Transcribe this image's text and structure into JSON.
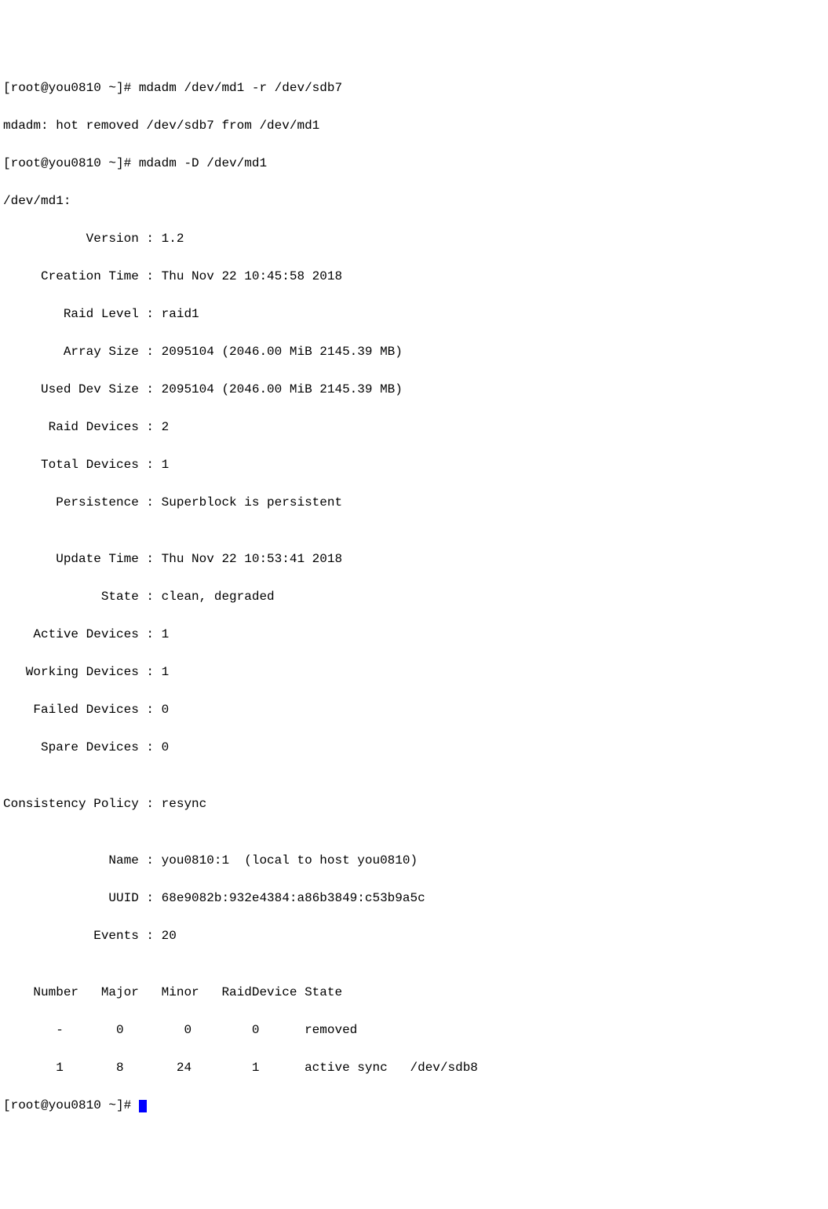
{
  "lines": {
    "l0": "[root@you0810 ~]# mdadm /dev/md1 -r /dev/sdb7",
    "l1": "mdadm: hot removed /dev/sdb7 from /dev/md1",
    "l2": "[root@you0810 ~]# mdadm -D /dev/md1",
    "l3": "/dev/md1:",
    "l4": "           Version : 1.2",
    "l5": "     Creation Time : Thu Nov 22 10:45:58 2018",
    "l6": "        Raid Level : raid1",
    "l7": "        Array Size : 2095104 (2046.00 MiB 2145.39 MB)",
    "l8": "     Used Dev Size : 2095104 (2046.00 MiB 2145.39 MB)",
    "l9": "      Raid Devices : 2",
    "l10": "     Total Devices : 1",
    "l11": "       Persistence : Superblock is persistent",
    "l12": "",
    "l13": "       Update Time : Thu Nov 22 10:53:41 2018",
    "l14": "             State : clean, degraded",
    "l15": "    Active Devices : 1",
    "l16": "   Working Devices : 1",
    "l17": "    Failed Devices : 0",
    "l18": "     Spare Devices : 0",
    "l19": "",
    "l20": "Consistency Policy : resync",
    "l21": "",
    "l22": "              Name : you0810:1  (local to host you0810)",
    "l23": "              UUID : 68e9082b:932e4384:a86b3849:c53b9a5c",
    "l24": "            Events : 20",
    "l25": "",
    "l26": "    Number   Major   Minor   RaidDevice State",
    "l27": "       -       0        0        0      removed",
    "l28": "       1       8       24        1      active sync   /dev/sdb8",
    "l29": "[root@you0810 ~]# "
  }
}
